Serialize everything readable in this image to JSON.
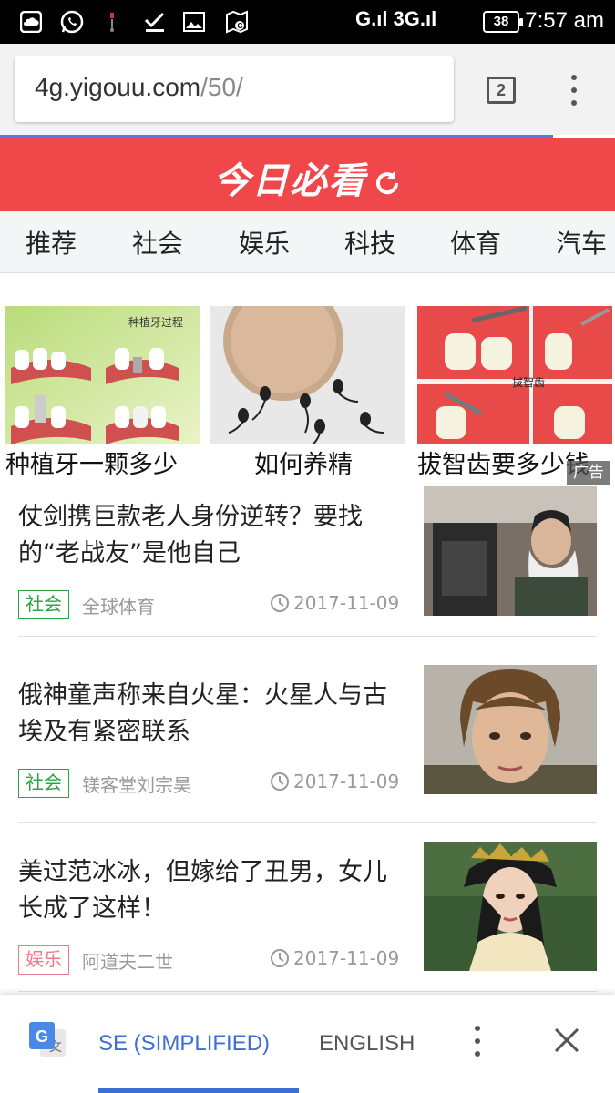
{
  "status_bar": {
    "signal_text": "G.ıl 3G.ıl",
    "battery": "38",
    "time": "7:57 am",
    "icons": [
      "cloud-icon",
      "whatsapp-icon",
      "usb-icon",
      "download-done-icon",
      "image-icon",
      "map-pin-icon"
    ]
  },
  "browser": {
    "url_host": "4g.yigouu.com",
    "url_path": "/50/",
    "tab_count": "2"
  },
  "app": {
    "logo_text": "今日必看",
    "accent_color": "#f0474a"
  },
  "tabs": [
    "推荐",
    "社会",
    "娱乐",
    "科技",
    "体育",
    "汽车"
  ],
  "ads": {
    "items": [
      {
        "caption": "种植牙一颗多少",
        "image_label": "种植牙过程"
      },
      {
        "caption": "如何养精"
      },
      {
        "caption": "拔智齿要多少钱",
        "image_label": "拔智齿"
      }
    ],
    "badge": "广告"
  },
  "news": [
    {
      "title": "仗剑携巨款老人身份逆转？要找的“老战友”是他自己",
      "tag": "社会",
      "tag_color": "#2aa542",
      "source": "全球体育",
      "date": "2017-11-09"
    },
    {
      "title": "俄神童声称来自火星：火星人与古埃及有紧密联系",
      "tag": "社会",
      "tag_color": "#2aa542",
      "source": "镁客堂刘宗昊",
      "date": "2017-11-09"
    },
    {
      "title": "美过范冰冰，但嫁给了丑男，女儿长成了这样！",
      "tag": "娱乐",
      "tag_color": "#f07a8a",
      "source": "阿道夫二世",
      "date": "2017-11-09"
    }
  ],
  "translate_bar": {
    "active_language": "SE (SIMPLIFIED)",
    "other_language": "ENGLISH",
    "active_color": "#3b6fd4"
  }
}
